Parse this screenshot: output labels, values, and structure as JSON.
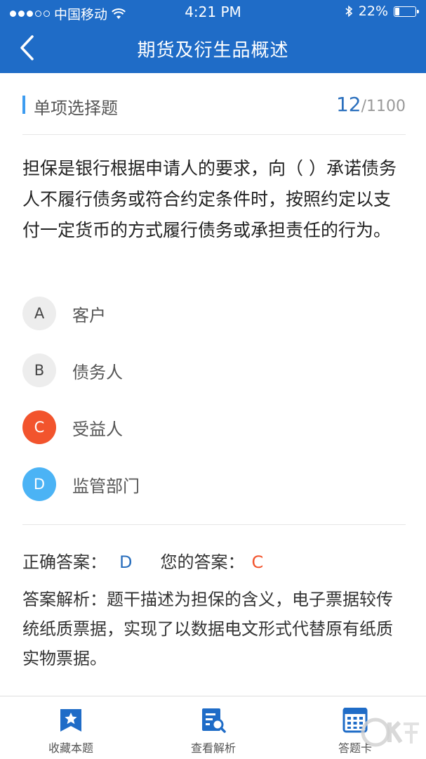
{
  "status_bar": {
    "carrier": "中国移动",
    "time": "4:21 PM",
    "battery": "22%",
    "battery_level": 0.22
  },
  "header": {
    "title": "期货及衍生品概述"
  },
  "section": {
    "label": "单项选择题",
    "current": "12",
    "total": "/1100"
  },
  "question": {
    "text": "担保是银行根据申请人的要求，向（ ）承诺债务人不履行债务或符合约定条件时，按照约定以支付一定货币的方式履行债务或承担责任的行为。"
  },
  "options": [
    {
      "letter": "A",
      "text": "客户",
      "state": "normal"
    },
    {
      "letter": "B",
      "text": "债务人",
      "state": "normal"
    },
    {
      "letter": "C",
      "text": "受益人",
      "state": "wrong"
    },
    {
      "letter": "D",
      "text": "监管部门",
      "state": "correct"
    }
  ],
  "answers": {
    "correct_label": "正确答案：",
    "correct_value": "D",
    "yours_label": "您的答案：",
    "yours_value": "C"
  },
  "analysis": {
    "text": "答案解析：题干描述为担保的含义，电子票据较传统纸质票据，实现了以数据电文形式代替原有纸质实物票据。"
  },
  "tabs": [
    {
      "label": "收藏本题",
      "icon": "bookmark-star-icon"
    },
    {
      "label": "查看解析",
      "icon": "document-search-icon"
    },
    {
      "label": "答题卡",
      "icon": "answer-card-icon"
    }
  ],
  "colors": {
    "header_bg": "#1f6cc7",
    "accent_blue": "#2a6fbd",
    "wrong_orange": "#f2542d",
    "correct_blue": "#4bb3f5"
  }
}
